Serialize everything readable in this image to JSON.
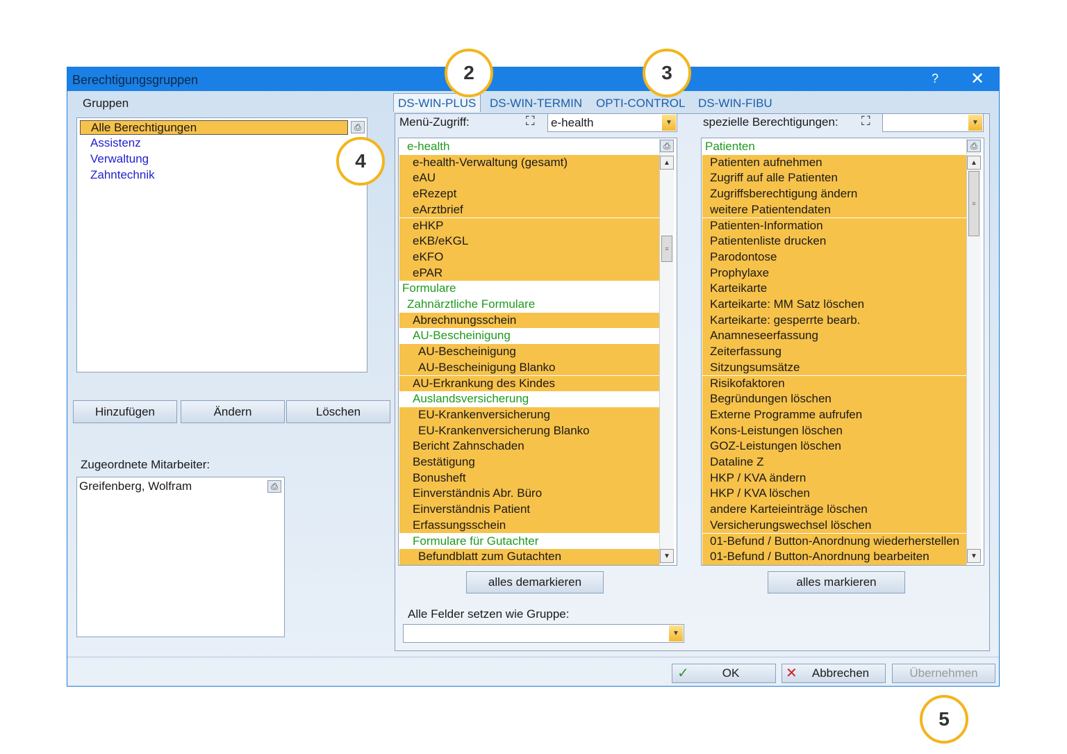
{
  "window": {
    "title": "Berechtigungsgruppen",
    "help_label": "?",
    "close_label": "✕"
  },
  "groups": {
    "label": "Gruppen",
    "items": [
      "Alle Berechtigungen",
      "Assistenz",
      "Verwaltung",
      "Zahntechnik"
    ],
    "selected": "Alle Berechtigungen",
    "buttons": {
      "add": "Hinzufügen",
      "change": "Ändern",
      "delete": "Löschen"
    }
  },
  "employees": {
    "label": "Zugeordnete Mitarbeiter:",
    "items": [
      "Greifenberg, Wolfram"
    ]
  },
  "tabs": [
    "DS-WIN-PLUS",
    "DS-WIN-TERMIN",
    "OPTI-CONTROL",
    "DS-WIN-FIBU"
  ],
  "menu_access": {
    "label": "Menü-Zugriff:",
    "combo_value": "e-health",
    "rows": [
      {
        "text": "e-health",
        "style": "g",
        "indent": 1
      },
      {
        "text": "e-health-Verwaltung (gesamt)",
        "style": "o",
        "indent": 2
      },
      {
        "text": "eAU",
        "style": "o",
        "indent": 2
      },
      {
        "text": "eRezept",
        "style": "o",
        "indent": 2
      },
      {
        "text": "eArztbrief",
        "style": "o",
        "indent": 2
      },
      {
        "text": "eHKP",
        "style": "o",
        "indent": 2
      },
      {
        "text": "eKB/eKGL",
        "style": "o",
        "indent": 2
      },
      {
        "text": "eKFO",
        "style": "o",
        "indent": 2
      },
      {
        "text": "ePAR",
        "style": "o",
        "indent": 2
      },
      {
        "text": "Formulare",
        "style": "g",
        "indent": 0
      },
      {
        "text": "Zahnärztliche Formulare",
        "style": "g",
        "indent": 1
      },
      {
        "text": "Abrechnungsschein",
        "style": "o",
        "indent": 2
      },
      {
        "text": "AU-Bescheinigung",
        "style": "g",
        "indent": 2
      },
      {
        "text": "AU-Bescheinigung",
        "style": "o",
        "indent": 3
      },
      {
        "text": "AU-Bescheinigung Blanko",
        "style": "o",
        "indent": 3
      },
      {
        "text": "AU-Erkrankung des Kindes",
        "style": "o",
        "indent": 2
      },
      {
        "text": "Auslandsversicherung",
        "style": "g",
        "indent": 2
      },
      {
        "text": "EU-Krankenversicherung",
        "style": "o",
        "indent": 3
      },
      {
        "text": "EU-Krankenversicherung Blanko",
        "style": "o",
        "indent": 3
      },
      {
        "text": "Bericht Zahnschaden",
        "style": "o",
        "indent": 2
      },
      {
        "text": "Bestätigung",
        "style": "o",
        "indent": 2
      },
      {
        "text": "Bonusheft",
        "style": "o",
        "indent": 2
      },
      {
        "text": "Einverständnis Abr. Büro",
        "style": "o",
        "indent": 2
      },
      {
        "text": "Einverständnis Patient",
        "style": "o",
        "indent": 2
      },
      {
        "text": "Erfassungsschein",
        "style": "o",
        "indent": 2
      },
      {
        "text": "Formulare für Gutachter",
        "style": "g",
        "indent": 2
      },
      {
        "text": "Befundblatt zum Gutachten",
        "style": "o",
        "indent": 3
      }
    ],
    "button": "alles demarkieren"
  },
  "special": {
    "label": "spezielle Berechtigungen:",
    "combo_value": "",
    "rows": [
      {
        "text": "Patienten",
        "style": "g",
        "indent": 0
      },
      {
        "text": "Patienten aufnehmen",
        "style": "o",
        "indent": 1
      },
      {
        "text": "Zugriff auf alle Patienten",
        "style": "o",
        "indent": 1
      },
      {
        "text": "Zugriffsberechtigung ändern",
        "style": "o",
        "indent": 1
      },
      {
        "text": "weitere Patientendaten",
        "style": "o",
        "indent": 1
      },
      {
        "text": "Patienten-Information",
        "style": "o",
        "indent": 1
      },
      {
        "text": "Patientenliste drucken",
        "style": "o",
        "indent": 1
      },
      {
        "text": "Parodontose",
        "style": "o",
        "indent": 1
      },
      {
        "text": "Prophylaxe",
        "style": "o",
        "indent": 1
      },
      {
        "text": "Karteikarte",
        "style": "o",
        "indent": 1
      },
      {
        "text": "Karteikarte: MM Satz löschen",
        "style": "o",
        "indent": 1
      },
      {
        "text": "Karteikarte: gesperrte bearb.",
        "style": "o",
        "indent": 1
      },
      {
        "text": "Anamneseerfassung",
        "style": "o",
        "indent": 1
      },
      {
        "text": "Zeiterfassung",
        "style": "o",
        "indent": 1
      },
      {
        "text": "Sitzungsumsätze",
        "style": "o",
        "indent": 1
      },
      {
        "text": "Risikofaktoren",
        "style": "o",
        "indent": 1
      },
      {
        "text": "Begründungen löschen",
        "style": "o",
        "indent": 1
      },
      {
        "text": "Externe Programme aufrufen",
        "style": "o",
        "indent": 1
      },
      {
        "text": "Kons-Leistungen löschen",
        "style": "o",
        "indent": 1
      },
      {
        "text": "GOZ-Leistungen löschen",
        "style": "o",
        "indent": 1
      },
      {
        "text": "Dataline Z",
        "style": "o",
        "indent": 1
      },
      {
        "text": "HKP / KVA ändern",
        "style": "o",
        "indent": 1
      },
      {
        "text": "HKP / KVA löschen",
        "style": "o",
        "indent": 1
      },
      {
        "text": "andere Karteieinträge löschen",
        "style": "o",
        "indent": 1
      },
      {
        "text": "Versicherungswechsel löschen",
        "style": "o",
        "indent": 1
      },
      {
        "text": "01-Befund / Button-Anordnung wiederherstellen",
        "style": "o",
        "indent": 1
      },
      {
        "text": "01-Befund / Button-Anordnung bearbeiten",
        "style": "o",
        "indent": 1
      }
    ],
    "button": "alles markieren"
  },
  "copy_group": {
    "label": "Alle Felder setzen wie Gruppe:",
    "value": ""
  },
  "footer": {
    "ok": "OK",
    "cancel": "Abbrechen",
    "apply": "Übernehmen"
  },
  "callouts": [
    "2",
    "3",
    "4",
    "5"
  ],
  "colors": {
    "accent": "#1a80e6",
    "highlight": "#f7c24a",
    "group_text": "#1f9a1f",
    "callout": "#f2b51d"
  }
}
